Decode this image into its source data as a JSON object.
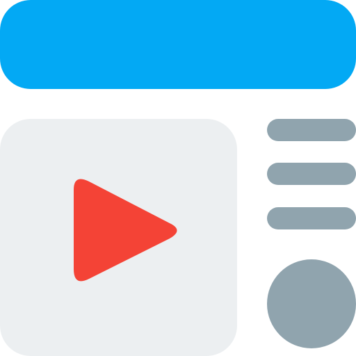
{
  "icon": {
    "name": "video-content-layout-icon",
    "colors": {
      "header": "#03A9F4",
      "panel": "#ECEFF1",
      "play": "#F44336",
      "lines": "#90A4AE",
      "circle": "#90A4AE"
    }
  },
  "header": {
    "icon": "header-bar"
  },
  "video": {
    "icon": "play-icon"
  },
  "sidebar": {
    "lines": [
      {
        "icon": "text-line"
      },
      {
        "icon": "text-line"
      },
      {
        "icon": "text-line"
      }
    ],
    "circle": {
      "icon": "circle-avatar"
    }
  }
}
